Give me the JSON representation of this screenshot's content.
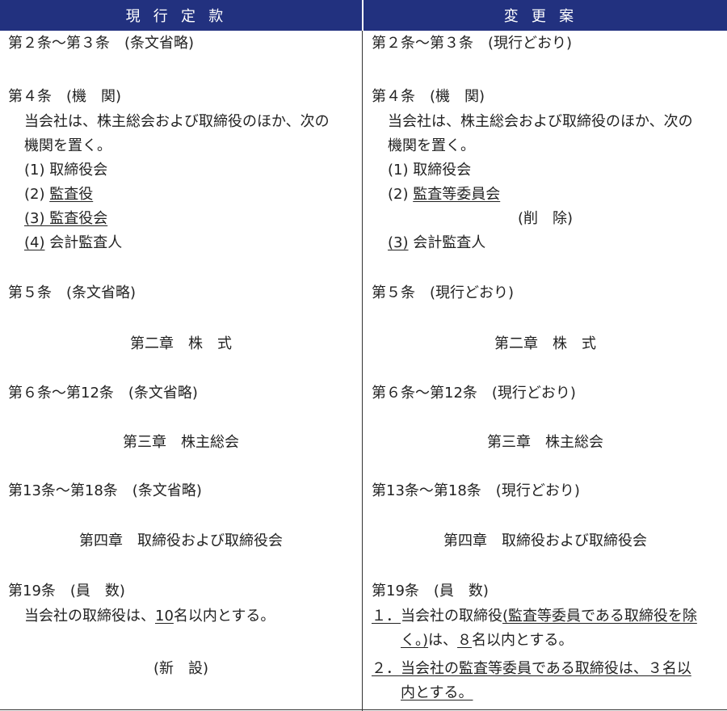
{
  "header": {
    "left": "現行定款",
    "right": "変更案"
  },
  "left": {
    "art2_3": "第２条～第３条　(条文省略)",
    "art4_title": "第４条　(機　関)",
    "art4_body1": "当会社は、株主総会および取締役のほか、次の",
    "art4_body2": "機関を置く。",
    "item1": "(1) 取締役会",
    "item2_prefix": "(2) ",
    "item2_text": "監査役",
    "item3": "(3) 監査役会",
    "item4_num": "(4)",
    "item4_text": " 会計監査人",
    "art5": "第５条　(条文省略)",
    "chapter2": "第二章　株　式",
    "art6_12": "第６条～第12条　(条文省略)",
    "chapter3": "第三章　株主総会",
    "art13_18": "第13条～第18条　(条文省略)",
    "chapter4": "第四章　取締役および取締役会",
    "art19_title": "第19条　(員　数)",
    "art19_a": "当会社の取締役は、",
    "art19_num": "10",
    "art19_b": "名以内とする。",
    "new": "(新　設)"
  },
  "right": {
    "art2_3": "第２条～第３条　(現行どおり)",
    "art4_title": "第４条　(機　関)",
    "art4_body1": "当会社は、株主総会および取締役のほか、次の",
    "art4_body2": "機関を置く。",
    "item1": "(1) 取締役会",
    "item2_prefix": "(2) ",
    "item2_text": "監査等委員会",
    "deleted": "(削　除)",
    "item3_num": "(3)",
    "item3_text": " 会計監査人",
    "art5": "第５条　(現行どおり)",
    "chapter2": "第二章　株　式",
    "art6_12": "第６条～第12条　(現行どおり)",
    "chapter3": "第三章　株主総会",
    "art13_18": "第13条～第18条　(現行どおり)",
    "chapter4": "第四章　取締役および取締役会",
    "art19_title": "第19条　(員　数)",
    "p1_num": "１．",
    "p1_a": "当会社の取締役",
    "p1_u": "(監査等委員である取締役を除",
    "p1_u2": "く。)",
    "p1_b": "は、",
    "p1_num8": "８",
    "p1_c": "名以内とする。",
    "p2_num": "２．",
    "p2_text1": "当会社の監査等委員である取締役は、３名以",
    "p2_text2": "内とする。"
  }
}
